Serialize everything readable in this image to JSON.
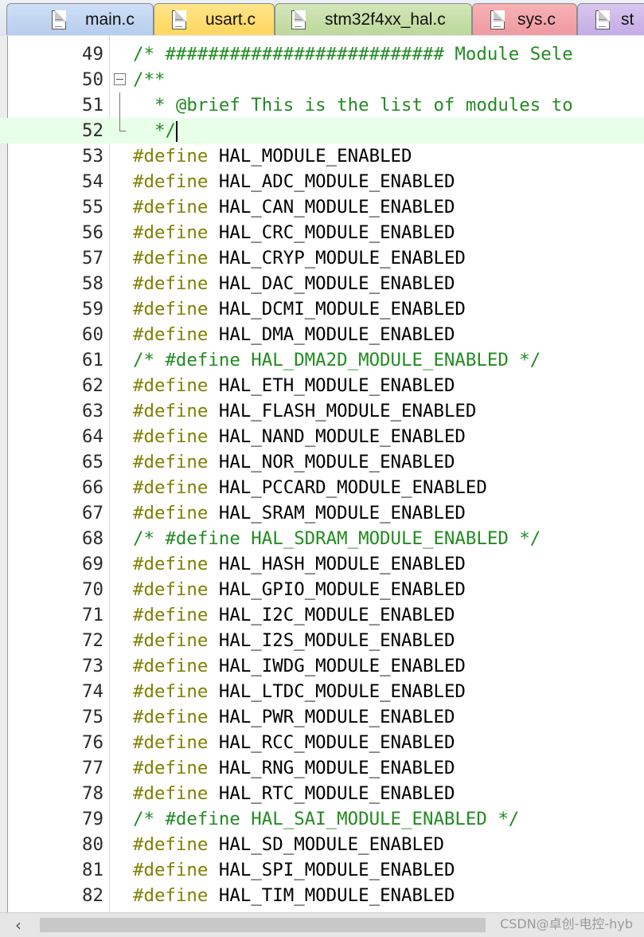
{
  "tabs": [
    {
      "label": "main.c",
      "icon": "file-icon"
    },
    {
      "label": "usart.c",
      "icon": "file-icon"
    },
    {
      "label": "stm32f4xx_hal.c",
      "icon": "file-icon"
    },
    {
      "label": "sys.c",
      "icon": "file-icon"
    },
    {
      "label": "st",
      "icon": "file-icon"
    }
  ],
  "editor": {
    "lines": [
      {
        "num": "49",
        "text": "/* ########################## Module Sele",
        "kind": "comment"
      },
      {
        "num": "50",
        "text": "/**",
        "kind": "comment"
      },
      {
        "num": "51",
        "text": "  * @brief This is the list of modules to",
        "kind": "comment"
      },
      {
        "num": "52",
        "text": "  */",
        "kind": "comment"
      },
      {
        "num": "53",
        "keyword": "#define",
        "macro": "HAL_MODULE_ENABLED",
        "kind": "define"
      },
      {
        "num": "54",
        "keyword": "#define",
        "macro": "HAL_ADC_MODULE_ENABLED",
        "kind": "define"
      },
      {
        "num": "55",
        "keyword": "#define",
        "macro": "HAL_CAN_MODULE_ENABLED",
        "kind": "define"
      },
      {
        "num": "56",
        "keyword": "#define",
        "macro": "HAL_CRC_MODULE_ENABLED",
        "kind": "define"
      },
      {
        "num": "57",
        "keyword": "#define",
        "macro": "HAL_CRYP_MODULE_ENABLED",
        "kind": "define"
      },
      {
        "num": "58",
        "keyword": "#define",
        "macro": "HAL_DAC_MODULE_ENABLED",
        "kind": "define"
      },
      {
        "num": "59",
        "keyword": "#define",
        "macro": "HAL_DCMI_MODULE_ENABLED",
        "kind": "define"
      },
      {
        "num": "60",
        "keyword": "#define",
        "macro": "HAL_DMA_MODULE_ENABLED",
        "kind": "define"
      },
      {
        "num": "61",
        "text": "/* #define HAL_DMA2D_MODULE_ENABLED */",
        "kind": "comment"
      },
      {
        "num": "62",
        "keyword": "#define",
        "macro": "HAL_ETH_MODULE_ENABLED",
        "kind": "define"
      },
      {
        "num": "63",
        "keyword": "#define",
        "macro": "HAL_FLASH_MODULE_ENABLED",
        "kind": "define"
      },
      {
        "num": "64",
        "keyword": "#define",
        "macro": "HAL_NAND_MODULE_ENABLED",
        "kind": "define"
      },
      {
        "num": "65",
        "keyword": "#define",
        "macro": "HAL_NOR_MODULE_ENABLED",
        "kind": "define"
      },
      {
        "num": "66",
        "keyword": "#define",
        "macro": "HAL_PCCARD_MODULE_ENABLED",
        "kind": "define"
      },
      {
        "num": "67",
        "keyword": "#define",
        "macro": "HAL_SRAM_MODULE_ENABLED",
        "kind": "define"
      },
      {
        "num": "68",
        "text": "/* #define HAL_SDRAM_MODULE_ENABLED */",
        "kind": "comment"
      },
      {
        "num": "69",
        "keyword": "#define",
        "macro": "HAL_HASH_MODULE_ENABLED",
        "kind": "define"
      },
      {
        "num": "70",
        "keyword": "#define",
        "macro": "HAL_GPIO_MODULE_ENABLED",
        "kind": "define"
      },
      {
        "num": "71",
        "keyword": "#define",
        "macro": "HAL_I2C_MODULE_ENABLED",
        "kind": "define"
      },
      {
        "num": "72",
        "keyword": "#define",
        "macro": "HAL_I2S_MODULE_ENABLED",
        "kind": "define"
      },
      {
        "num": "73",
        "keyword": "#define",
        "macro": "HAL_IWDG_MODULE_ENABLED",
        "kind": "define"
      },
      {
        "num": "74",
        "keyword": "#define",
        "macro": "HAL_LTDC_MODULE_ENABLED",
        "kind": "define"
      },
      {
        "num": "75",
        "keyword": "#define",
        "macro": "HAL_PWR_MODULE_ENABLED",
        "kind": "define"
      },
      {
        "num": "76",
        "keyword": "#define",
        "macro": "HAL_RCC_MODULE_ENABLED",
        "kind": "define"
      },
      {
        "num": "77",
        "keyword": "#define",
        "macro": "HAL_RNG_MODULE_ENABLED",
        "kind": "define"
      },
      {
        "num": "78",
        "keyword": "#define",
        "macro": "HAL_RTC_MODULE_ENABLED",
        "kind": "define"
      },
      {
        "num": "79",
        "text": "/* #define HAL_SAI_MODULE_ENABLED */",
        "kind": "comment"
      },
      {
        "num": "80",
        "keyword": "#define",
        "macro": "HAL_SD_MODULE_ENABLED",
        "kind": "define"
      },
      {
        "num": "81",
        "keyword": "#define",
        "macro": "HAL_SPI_MODULE_ENABLED",
        "kind": "define"
      },
      {
        "num": "82",
        "keyword": "#define",
        "macro": "HAL_TIM_MODULE_ENABLED",
        "kind": "define"
      }
    ],
    "current_line": "52",
    "fold_line": "50",
    "colors": {
      "comment": "#218b21",
      "keyword": "#808000",
      "current_line_bg": "#e8ffe8"
    }
  },
  "scrollbar": {
    "left_arrow": "‹",
    "icon": "chevron-left-icon"
  },
  "watermark": "CSDN@卓创-电控-hyb"
}
